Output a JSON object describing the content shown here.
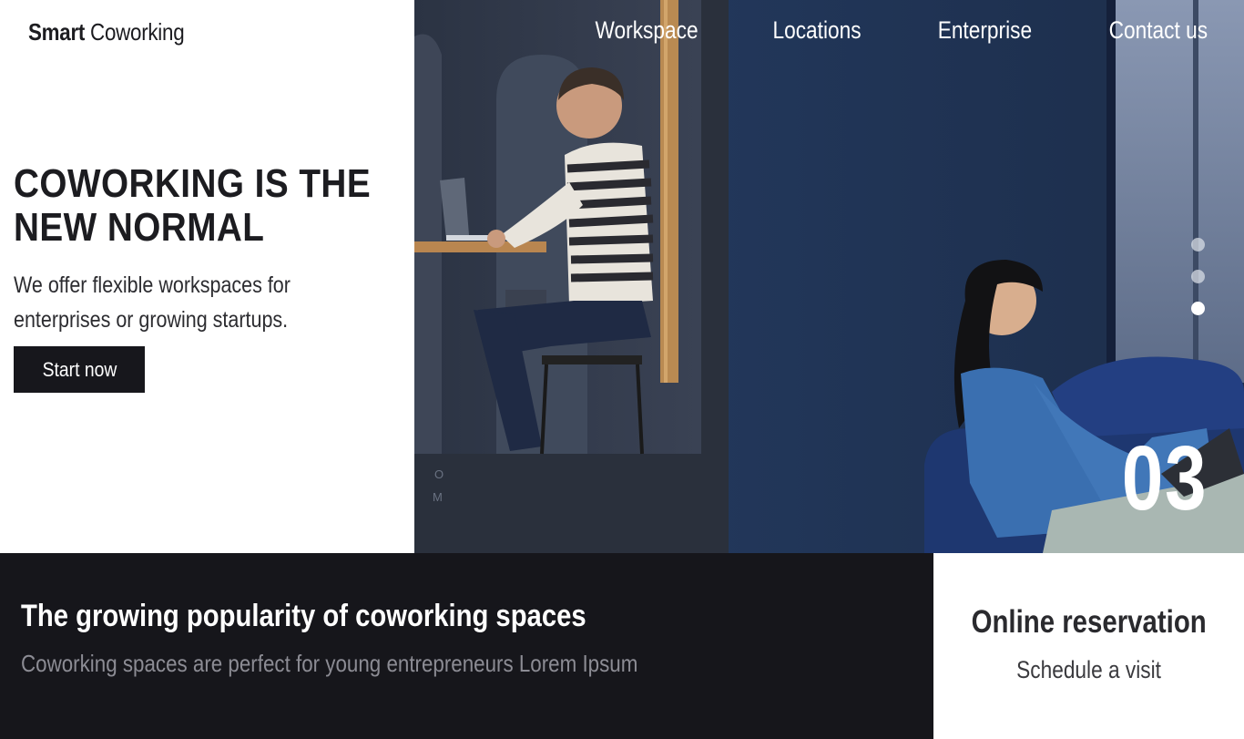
{
  "header": {
    "brand_bold": "Smart",
    "brand_light": "Coworking",
    "nav": [
      "Workspace",
      "Locations",
      "Enterprise",
      "Contact us"
    ]
  },
  "hero": {
    "title": "COWORKING IS THE NEW NORMAL",
    "description": "We offer flexible workspaces for enterprises or growing startups.",
    "cta_label": "Start now",
    "slide_counter": "03",
    "slide_count": 3,
    "active_slide": 3
  },
  "feature": {
    "title": "The growing popularity of coworking spaces",
    "subtitle": "Coworking spaces are perfect for young entrepreneurs Lorem Ipsum"
  },
  "reservation": {
    "title": "Online reservation",
    "link_label": "Schedule a visit"
  },
  "colors": {
    "dark": "#16161b",
    "photo_blue": "#1f2c44",
    "accent_white": "#ffffff"
  }
}
